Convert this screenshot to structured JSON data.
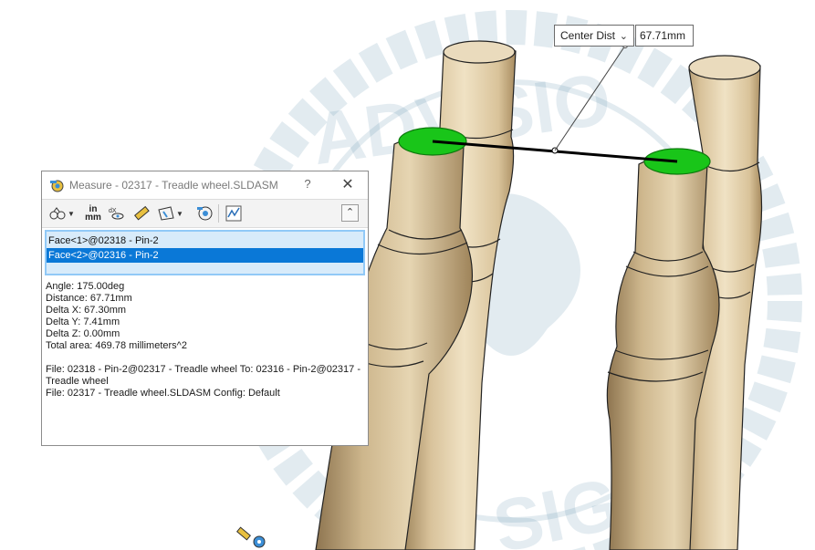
{
  "callout": {
    "dropdown_label": "Center Dist",
    "value": "67.71mm"
  },
  "dialog": {
    "title": "Measure - 02317 - Treadle wheel.SLDASM",
    "help_label": "?",
    "close_label": "✕",
    "toolbar": {
      "units_top": "in",
      "units_bottom": "mm",
      "collapse_label": "⌃"
    },
    "selections": [
      {
        "label": "Face<1>@02318 - Pin-2",
        "selected": false
      },
      {
        "label": "Face<2>@02316 - Pin-2",
        "selected": true
      }
    ],
    "results": {
      "angle": "Angle: 175.00deg",
      "distance": "Distance: 67.71mm",
      "delta_x": "Delta X: 67.30mm",
      "delta_y": "Delta Y: 7.41mm",
      "delta_z": "Delta Z: 0.00mm",
      "total_area": "Total area: 469.78 millimeters^2",
      "file_line_1": "File: 02318 - Pin-2@02317 - Treadle wheel To: 02316 - Pin-2@02317 - Treadle wheel",
      "file_line_2": "File: 02317 - Treadle wheel.SLDASM Config: Default"
    }
  },
  "watermark": {
    "text_top": "ADVISIO",
    "text_bottom": "SIGN"
  },
  "colors": {
    "face_highlight": "#19c519",
    "wood": "#dcc7a0",
    "selection_blue": "#0a78d7",
    "list_bg": "#d8ebfa"
  }
}
